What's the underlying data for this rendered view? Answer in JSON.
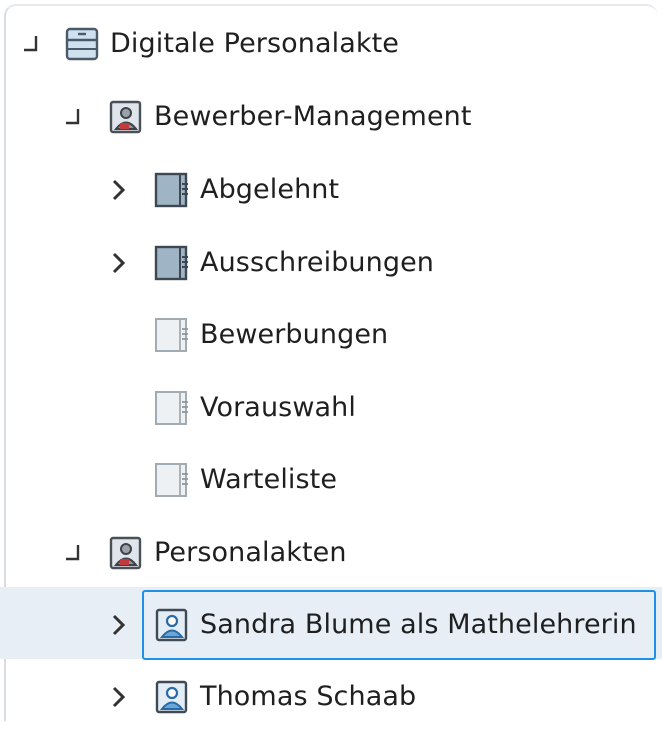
{
  "tree": {
    "root": {
      "label": "Digitale Personalakte",
      "icon": "cabinet-icon",
      "expanded": true
    },
    "groups": [
      {
        "label": "Bewerber-Management",
        "icon": "person-folder-icon",
        "expanded": true,
        "children": [
          {
            "label": "Abgelehnt",
            "icon": "register-icon",
            "expandable": true
          },
          {
            "label": "Ausschreibungen",
            "icon": "register-icon",
            "expandable": true
          },
          {
            "label": "Bewerbungen",
            "icon": "register-empty-icon",
            "expandable": false
          },
          {
            "label": "Vorauswahl",
            "icon": "register-empty-icon",
            "expandable": false
          },
          {
            "label": "Warteliste",
            "icon": "register-empty-icon",
            "expandable": false
          }
        ]
      },
      {
        "label": "Personalakten",
        "icon": "person-folder-icon",
        "expanded": true,
        "children": [
          {
            "label": "Sandra Blume als Mathelehrerin",
            "icon": "person-file-icon",
            "expandable": true,
            "selected": true
          },
          {
            "label": "Thomas Schaab",
            "icon": "person-file-icon",
            "expandable": true
          }
        ]
      }
    ]
  },
  "colors": {
    "selection_border": "#1e90e6",
    "selection_fill": "#e8eef5"
  }
}
